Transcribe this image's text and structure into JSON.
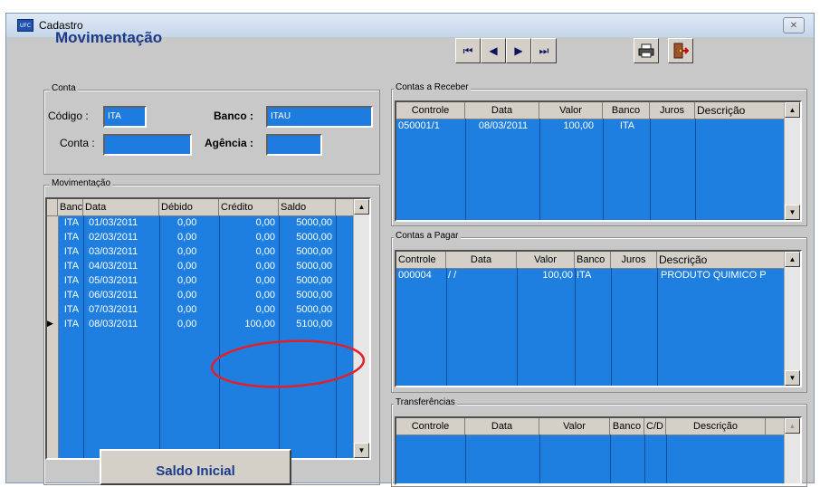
{
  "window": {
    "title": "Cadastro",
    "app_icon": "UFC",
    "close_label": "✕"
  },
  "heading": "Movimentação",
  "nav": [
    "⏮",
    "◀",
    "▶",
    "⏭"
  ],
  "toolbar_icons": [
    "printer-icon",
    "exit-door-icon"
  ],
  "conta": {
    "group_label": "Conta",
    "codigo_label": "Código :",
    "codigo_value": "ITA",
    "banco_label": "Banco :",
    "banco_value": "ITAU",
    "conta_label": "Conta :",
    "conta_value": "",
    "agencia_label": "Agência :",
    "agencia_value": ""
  },
  "movimentacao": {
    "group_label": "Movimentação",
    "columns": [
      "Banco",
      "Data",
      "Débido",
      "Crédito",
      "Saldo"
    ],
    "rows": [
      [
        "ITA",
        "01/03/2011",
        "0,00",
        "0,00",
        "5000,00"
      ],
      [
        "ITA",
        "02/03/2011",
        "0,00",
        "0,00",
        "5000,00"
      ],
      [
        "ITA",
        "03/03/2011",
        "0,00",
        "0,00",
        "5000,00"
      ],
      [
        "ITA",
        "04/03/2011",
        "0,00",
        "0,00",
        "5000,00"
      ],
      [
        "ITA",
        "05/03/2011",
        "0,00",
        "0,00",
        "5000,00"
      ],
      [
        "ITA",
        "06/03/2011",
        "0,00",
        "0,00",
        "5000,00"
      ],
      [
        "ITA",
        "07/03/2011",
        "0,00",
        "0,00",
        "5000,00"
      ],
      [
        "ITA",
        "08/03/2011",
        "0,00",
        "100,00",
        "5100,00"
      ]
    ],
    "current_row_marker": "▶"
  },
  "saldo_button": "Saldo Inicial",
  "receber": {
    "group_label": "Contas a Receber",
    "columns": [
      "Controle",
      "Data",
      "Valor",
      "Banco",
      "Juros",
      "Descrição"
    ],
    "rows": [
      [
        "050001/1",
        "08/03/2011",
        "100,00",
        "ITA",
        "",
        ""
      ]
    ]
  },
  "pagar": {
    "group_label": "Contas a Pagar",
    "columns": [
      "Controle",
      "Data",
      "Valor",
      "Banco",
      "Juros",
      "Descrição"
    ],
    "rows": [
      [
        "000004",
        "/ /",
        "100,00",
        "ITA",
        "",
        "PRODUTO QUIMICO P"
      ]
    ]
  },
  "transf": {
    "group_label": "Transferências",
    "columns": [
      "Controle",
      "Data",
      "Valor",
      "Banco",
      "C/D",
      "Descrição"
    ]
  },
  "colors": {
    "grid_blue": "#1f7fe0",
    "heading_blue": "#1a3a8c",
    "annotation_red": "#e0202a"
  }
}
